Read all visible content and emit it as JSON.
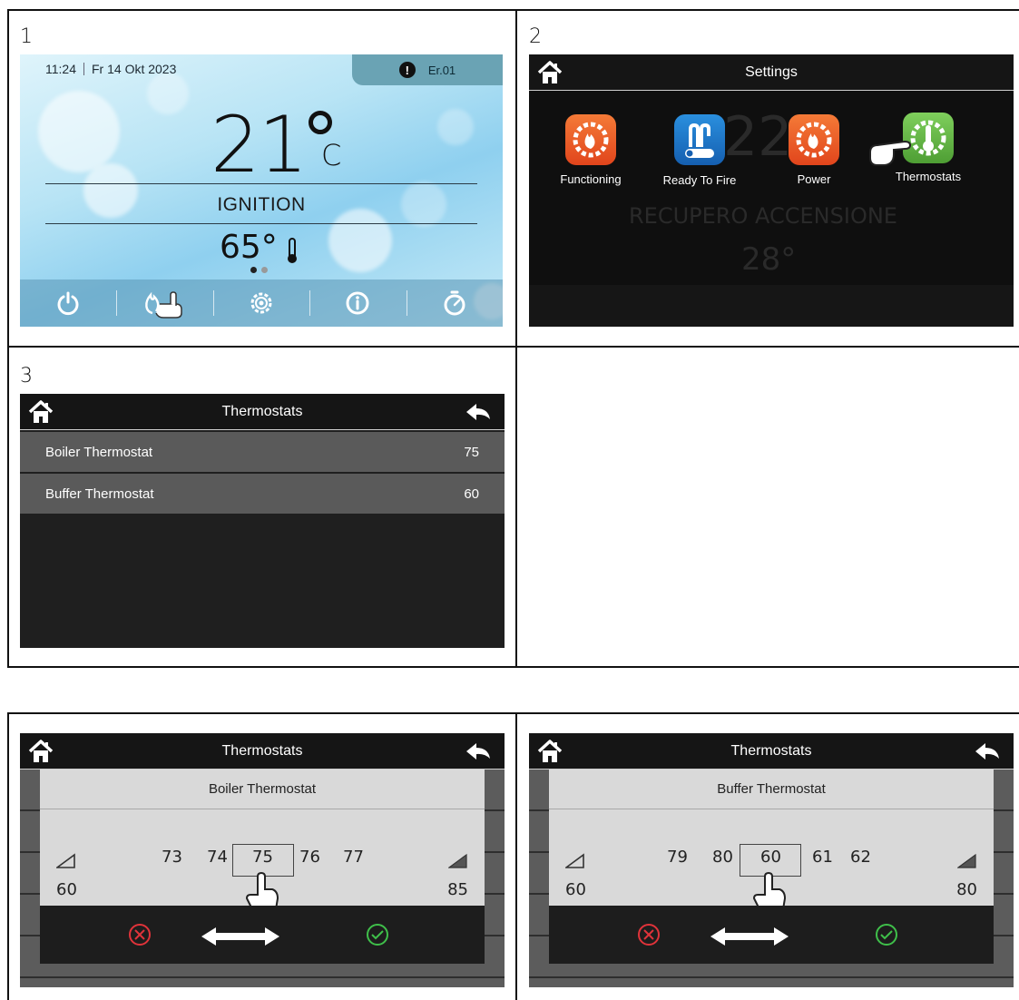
{
  "steps": [
    "1",
    "2",
    "3"
  ],
  "screen1": {
    "time": "11:24",
    "date": "Fr 14 Okt 2023",
    "error_code": "Er.01",
    "room_temp": "21",
    "temp_unit": "C",
    "status": "IGNITION",
    "water_temp": "65°",
    "bottom_buttons": [
      "power-icon",
      "flame-hand-icon",
      "settings-gear-icon",
      "info-icon",
      "timer-icon"
    ]
  },
  "screen2": {
    "title": "Settings",
    "background_ghost": {
      "temp": "22",
      "status": "RECUPERO ACCENSIONE",
      "water": "28°"
    },
    "tiles": [
      {
        "label": "Functioning",
        "icon": "flame-gear-icon",
        "color": "#ef5a24"
      },
      {
        "label": "Ready To Fire",
        "icon": "radiator-toggle-icon",
        "color": "#1b78c8"
      },
      {
        "label": "Power",
        "icon": "flame-gear-icon",
        "color": "#ef5a24"
      },
      {
        "label": "Thermostats",
        "icon": "thermometer-gear-icon",
        "color": "#6cba4a"
      }
    ]
  },
  "screen3": {
    "title": "Thermostats",
    "rows": [
      {
        "label": "Boiler Thermostat",
        "value": "75"
      },
      {
        "label": "Buffer Thermostat",
        "value": "60"
      }
    ]
  },
  "screen4": {
    "title": "Thermostats",
    "dialog_title": "Boiler Thermostat",
    "values": [
      "73",
      "74",
      "75",
      "76",
      "77"
    ],
    "selected": "75",
    "min": "60",
    "max": "85"
  },
  "screen5": {
    "title": "Thermostats",
    "dialog_title": "Buffer Thermostat",
    "values": [
      "79",
      "80",
      "60",
      "61",
      "62"
    ],
    "selected": "60",
    "min": "60",
    "max": "80"
  },
  "colors": {
    "cancel": "#e0333a",
    "confirm": "#3fbf4a",
    "accent_orange": "#ef5a24",
    "accent_blue": "#1b78c8",
    "accent_green": "#6cba4a"
  }
}
